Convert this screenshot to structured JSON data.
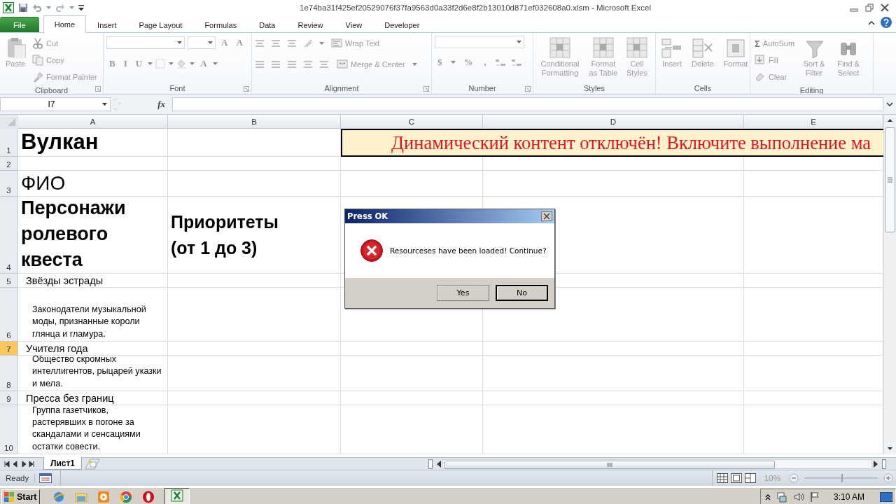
{
  "window": {
    "title": "1e74ba31f425ef20529076f37fa9563d0a33f2d6e8f2b13010d871ef032608a0.xlsm - Microsoft Excel"
  },
  "ribbon_tabs": [
    {
      "label": "File",
      "kind": "file",
      "selected": false
    },
    {
      "label": "Home",
      "kind": "tab",
      "selected": true
    },
    {
      "label": "Insert",
      "kind": "tab",
      "selected": false
    },
    {
      "label": "Page Layout",
      "kind": "tab",
      "selected": false
    },
    {
      "label": "Formulas",
      "kind": "tab",
      "selected": false
    },
    {
      "label": "Data",
      "kind": "tab",
      "selected": false
    },
    {
      "label": "Review",
      "kind": "tab",
      "selected": false
    },
    {
      "label": "View",
      "kind": "tab",
      "selected": false
    },
    {
      "label": "Developer",
      "kind": "tab",
      "selected": false
    }
  ],
  "ribbon_groups": [
    {
      "label": "Clipboard",
      "commands": [
        {
          "kind": "large",
          "label": "Paste",
          "disabled": true
        },
        {
          "kind": "small",
          "label": "Cut",
          "disabled": true
        },
        {
          "kind": "small",
          "label": "Copy",
          "disabled": true
        },
        {
          "kind": "small",
          "label": "Format Painter",
          "disabled": true
        }
      ]
    },
    {
      "label": "Font",
      "commands": [
        {
          "kind": "combo"
        },
        {
          "kind": "combo"
        },
        {
          "kind": "glyph",
          "label": "A",
          "disabled": true
        },
        {
          "kind": "glyph",
          "label": "A",
          "disabled": true
        },
        {
          "kind": "glyph",
          "label": "B",
          "disabled": true
        },
        {
          "kind": "glyph",
          "label": "I",
          "disabled": true
        },
        {
          "kind": "glyph",
          "label": "U",
          "disabled": true
        },
        {
          "kind": "icon",
          "disabled": true
        },
        {
          "kind": "icon",
          "disabled": true
        },
        {
          "kind": "glyph",
          "label": "A",
          "disabled": true
        }
      ]
    },
    {
      "label": "Alignment",
      "commands": [
        {
          "kind": "icon",
          "disabled": true
        },
        {
          "kind": "icon",
          "disabled": true
        },
        {
          "kind": "icon",
          "disabled": true
        },
        {
          "kind": "icon",
          "disabled": true
        },
        {
          "kind": "small",
          "label": "Wrap Text",
          "disabled": true
        },
        {
          "kind": "icon",
          "disabled": true
        },
        {
          "kind": "icon",
          "disabled": true
        },
        {
          "kind": "icon",
          "disabled": true
        },
        {
          "kind": "icon",
          "disabled": true
        },
        {
          "kind": "icon",
          "disabled": true
        },
        {
          "kind": "small",
          "label": "Merge & Center",
          "disabled": true
        }
      ]
    },
    {
      "label": "Number",
      "commands": [
        {
          "kind": "combo"
        },
        {
          "kind": "glyph",
          "label": "$",
          "disabled": true
        },
        {
          "kind": "glyph",
          "label": "%",
          "disabled": true
        },
        {
          "kind": "glyph",
          "label": ",",
          "disabled": true
        },
        {
          "kind": "icon",
          "disabled": true
        },
        {
          "kind": "icon",
          "disabled": true
        }
      ]
    },
    {
      "label": "Styles",
      "commands": [
        {
          "kind": "large",
          "label": "Conditional Formatting",
          "disabled": true
        },
        {
          "kind": "large",
          "label": "Format as Table",
          "disabled": true
        },
        {
          "kind": "large",
          "label": "Cell Styles",
          "disabled": true
        }
      ]
    },
    {
      "label": "Cells",
      "commands": [
        {
          "kind": "large",
          "label": "Insert",
          "disabled": true
        },
        {
          "kind": "large",
          "label": "Delete",
          "disabled": true
        },
        {
          "kind": "large",
          "label": "Format",
          "disabled": true
        }
      ]
    },
    {
      "label": "Editing",
      "commands": [
        {
          "kind": "small",
          "label": "AutoSum",
          "symbol": "Σ",
          "disabled": true
        },
        {
          "kind": "small",
          "label": "Fill",
          "disabled": true
        },
        {
          "kind": "small",
          "label": "Clear",
          "disabled": true
        },
        {
          "kind": "large",
          "label": "Sort & Filter",
          "disabled": true
        },
        {
          "kind": "large",
          "label": "Find & Select",
          "disabled": true
        }
      ]
    }
  ],
  "formula_bar": {
    "name_box": "I7",
    "function_label": "fx"
  },
  "columns": [
    "A",
    "B",
    "C",
    "D",
    "E"
  ],
  "rows": [
    {
      "number": "1",
      "kind": "title",
      "selected": false,
      "cells": [
        "Вулкан"
      ]
    },
    {
      "number": "2",
      "selected": false,
      "cells": []
    },
    {
      "number": "3",
      "kind": "label",
      "selected": false,
      "cells": [
        "ФИО"
      ]
    },
    {
      "number": "4",
      "kind": "heading",
      "selected": false,
      "cells": [
        "Персонажи ролевого квеста",
        "Приоритеты (от 1 до 3)"
      ]
    },
    {
      "number": "5",
      "kind": "group",
      "selected": false,
      "cells": [
        "Звёзды эстрады"
      ]
    },
    {
      "number": "6",
      "kind": "description",
      "selected": false,
      "cells": [
        "Законодатели музыкальной моды, признанные короли глянца и гламура."
      ]
    },
    {
      "number": "7",
      "kind": "group",
      "selected": true,
      "cells": [
        "Учителя года"
      ]
    },
    {
      "number": "8",
      "kind": "description",
      "selected": false,
      "cells": [
        "Общество скромных интеллигентов, рыцарей указки и мела."
      ]
    },
    {
      "number": "9",
      "kind": "group",
      "selected": false,
      "cells": [
        "Пресса без границ"
      ]
    },
    {
      "number": "10",
      "kind": "description",
      "selected": false,
      "cells": [
        "Группа газетчиков, растерявших в погоне за скандалами и сенсациями остатки совести."
      ]
    }
  ],
  "banner": {
    "text": "Динамический контент отключён! Включите выполнение ма"
  },
  "dialog": {
    "title": "Press OK",
    "message": "Resourceses have been loaded! Continue?",
    "buttons": [
      {
        "label": "Yes",
        "selected": false
      },
      {
        "label": "No",
        "selected": true
      }
    ]
  },
  "sheet_tabs": [
    {
      "label": "Лист1",
      "selected": true
    }
  ],
  "status_bar": {
    "status": "Ready",
    "zoom": "10%",
    "level": 0.5
  },
  "taskbar": {
    "start": "Start",
    "clock": "3:10 AM"
  }
}
